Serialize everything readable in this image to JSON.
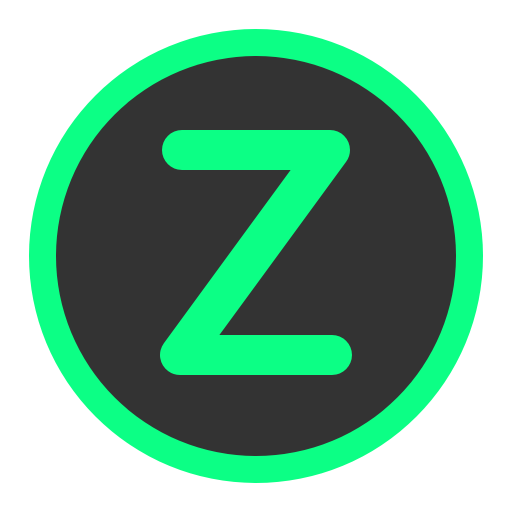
{
  "logo": {
    "letter": "Z",
    "colors": {
      "ring": "#0cff85",
      "disc": "#333333",
      "letter": "#0cff85",
      "background": "#ffffff"
    }
  }
}
